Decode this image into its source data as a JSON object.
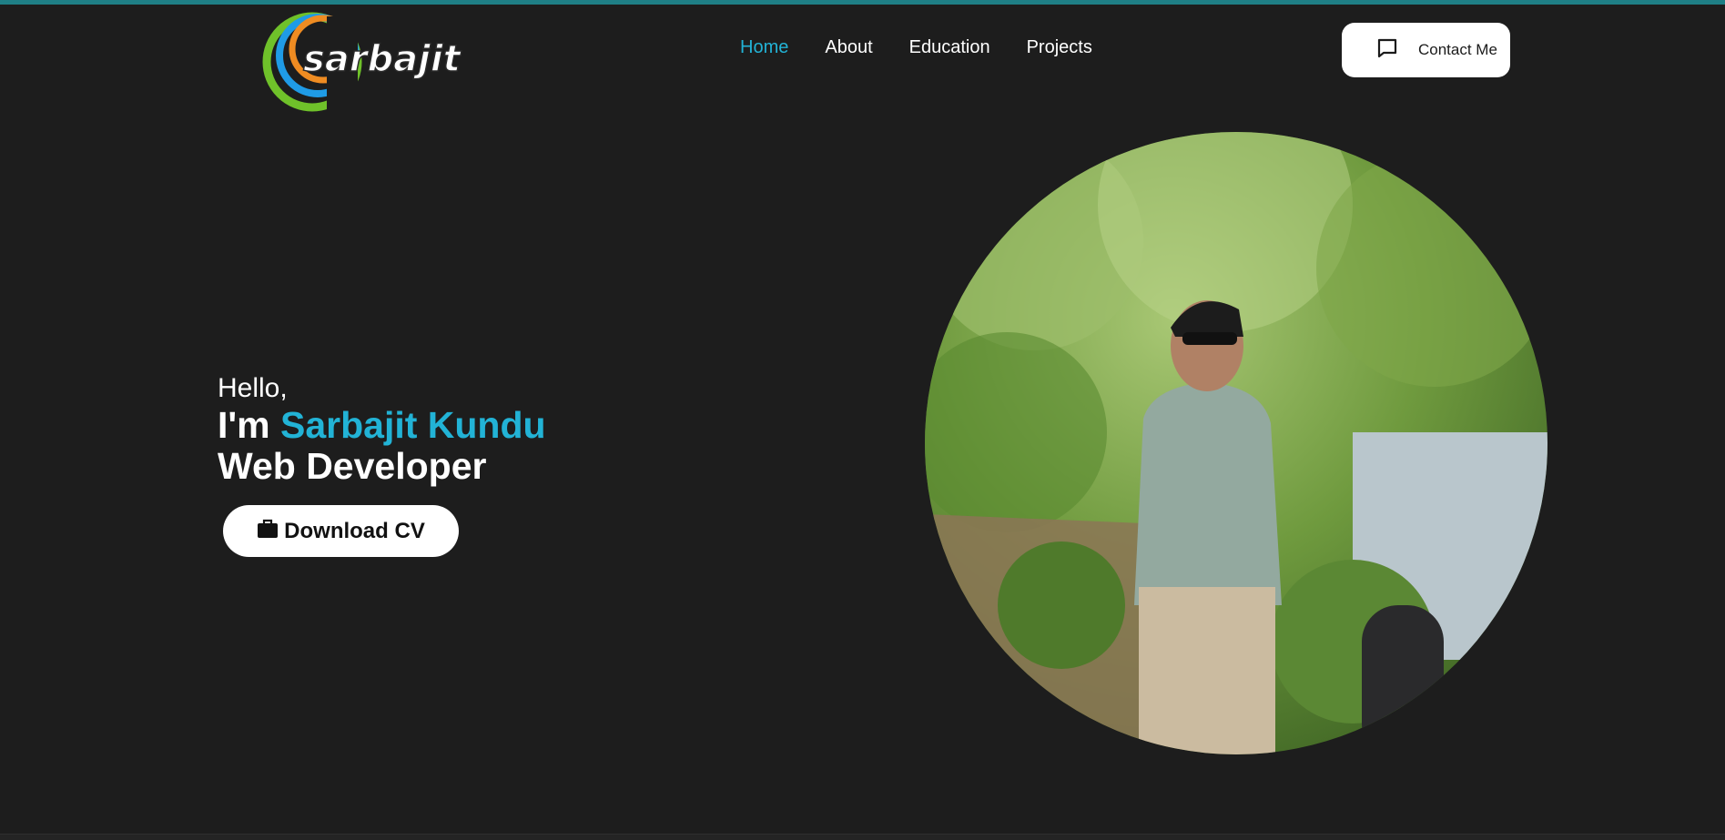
{
  "header": {
    "logo_text": "sarbajit",
    "nav": [
      {
        "label": "Home",
        "active": true
      },
      {
        "label": "About",
        "active": false
      },
      {
        "label": "Education",
        "active": false
      },
      {
        "label": "Projects",
        "active": false
      }
    ],
    "contact_label": "Contact Me",
    "contact_icon": "message-square-icon"
  },
  "hero": {
    "greeting": "Hello,",
    "intro_prefix": "I'm ",
    "name": "Sarbajit Kundu",
    "role": "Web Developer",
    "cv_label": "Download CV",
    "cv_icon": "briefcase-icon"
  },
  "colors": {
    "background": "#1d1d1d",
    "accent": "#22b3d6",
    "button_bg": "#ffffff",
    "top_strip": "#1f7f86"
  }
}
